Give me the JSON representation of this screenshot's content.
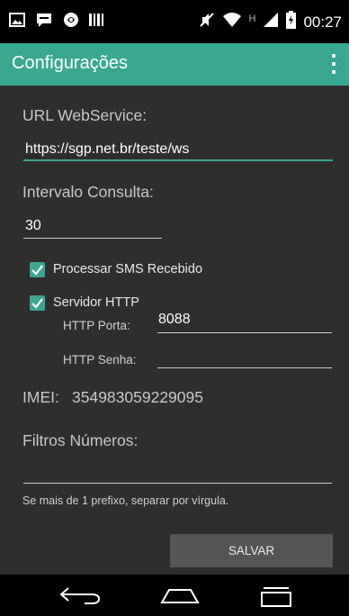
{
  "status_bar": {
    "time": "00:27",
    "network_type": "H",
    "left_icons": [
      "image-notification-icon",
      "chat-notification-icon",
      "app-notification-icon",
      "barcode-notification-icon"
    ],
    "right_icons": [
      "mute-icon",
      "wifi-icon",
      "signal-icon",
      "battery-icon"
    ]
  },
  "action_bar": {
    "title": "Configurações",
    "overflow_icon": "more-vert-icon",
    "color": "#3aa790"
  },
  "form": {
    "url_label": "URL WebService:",
    "url_value": "https://sgp.net.br/teste/ws",
    "interval_label": "Intervalo Consulta:",
    "interval_value": "30",
    "checkbox_sms": {
      "label": "Processar SMS Recebido",
      "checked": true
    },
    "checkbox_http": {
      "label": "Servidor HTTP",
      "checked": true
    },
    "http_port_label": "HTTP Porta:",
    "http_port_value": "8088",
    "http_password_label": "HTTP Senha:",
    "http_password_value": "",
    "imei_label": "IMEI:",
    "imei_value": "354983059229095",
    "filters_label": "Filtros Números:",
    "filters_value": "",
    "filters_hint": "Se mais de 1 prefixo, separar por vírgula.",
    "save_button": "SALVAR"
  },
  "nav_bar": {
    "buttons": [
      "back-icon",
      "home-icon",
      "recents-icon"
    ]
  }
}
